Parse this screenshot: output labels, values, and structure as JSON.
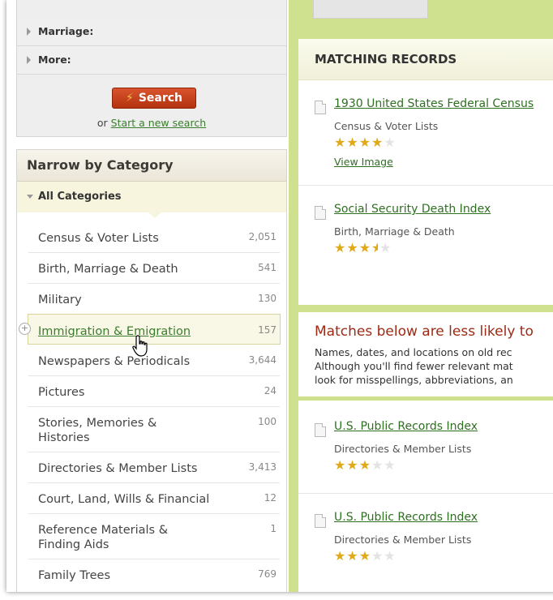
{
  "search_box": {
    "rows": [
      {
        "label": "Marriage:"
      },
      {
        "label": "More:"
      }
    ],
    "search_button": "Search",
    "or_text": "or",
    "new_search_link": "Start a new search"
  },
  "narrow": {
    "heading": "Narrow by Category",
    "all_categories": "All Categories",
    "categories": [
      {
        "name": "Census & Voter Lists",
        "count": "2,051"
      },
      {
        "name": "Birth, Marriage & Death",
        "count": "541"
      },
      {
        "name": "Military",
        "count": "130"
      },
      {
        "name": "Immigration & Emigration",
        "count": "157"
      },
      {
        "name": "Newspapers & Periodicals",
        "count": "3,644"
      },
      {
        "name": "Pictures",
        "count": "24"
      },
      {
        "name": "Stories, Memories & Histories",
        "count": "100"
      },
      {
        "name": "Directories & Member Lists",
        "count": "3,413"
      },
      {
        "name": "Court, Land, Wills & Financial",
        "count": "12"
      },
      {
        "name": "Reference Materials & Finding Aids",
        "count": "1"
      },
      {
        "name": "Family Trees",
        "count": "769"
      }
    ]
  },
  "matching": {
    "heading": "MATCHING RECORDS",
    "records": [
      {
        "title": "1930 United States Federal Census",
        "category": "Census & Voter Lists",
        "stars": 4,
        "link": "View Image"
      },
      {
        "title": "Social Security Death Index",
        "category": "Birth, Marriage & Death",
        "stars": 3.5
      }
    ]
  },
  "less_likely": {
    "title": "Matches below are less likely to",
    "lines": [
      "Names, dates, and locations on old rec",
      "Although you'll find fewer relevant mat",
      "look for misspellings, abbreviations, an"
    ],
    "records": [
      {
        "title": "U.S. Public Records Index",
        "category": "Directories & Member Lists",
        "stars": 3
      },
      {
        "title": "U.S. Public Records Index",
        "category": "Directories & Member Lists",
        "stars": 3
      }
    ]
  },
  "colors": {
    "accent_green": "#cfe08f",
    "link_green": "#2f6f22",
    "search_red": "#c4401d",
    "warning_red": "#9c2a14",
    "star_gold": "#e0a91a"
  }
}
